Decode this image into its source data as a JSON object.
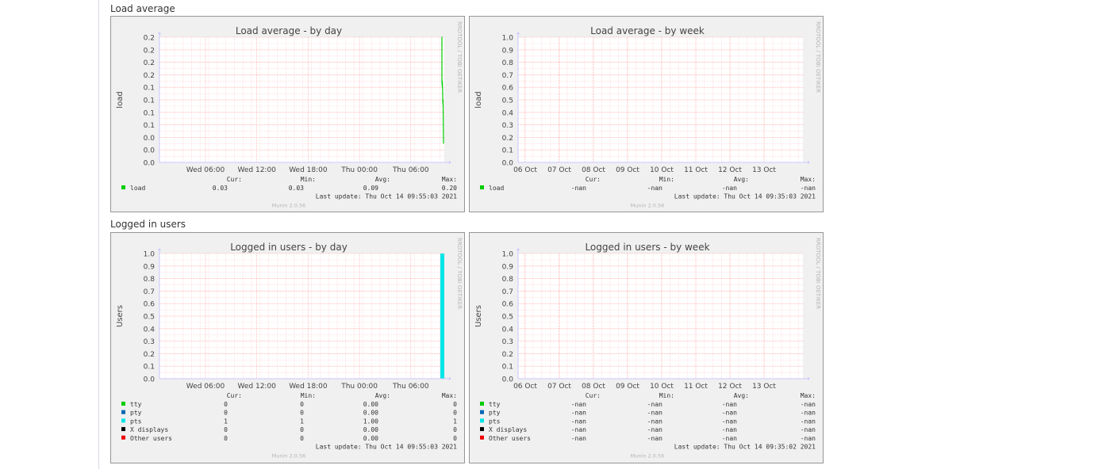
{
  "sections": [
    {
      "title": "Load average"
    },
    {
      "title": "Logged in users"
    }
  ],
  "side_text": "RRDTOOL / TOBI OETIKER",
  "footer_credit": "Munin 2.0.56",
  "labels": {
    "cur": "Cur:",
    "min": "Min:",
    "avg": "Avg:",
    "max": "Max:"
  },
  "colors": {
    "grid": "#ff9999",
    "axis": "#c8c8ff",
    "green": "#00cc00",
    "violet": "#0066b3",
    "cyan": "#00e6e6",
    "black": "#000000",
    "red": "#ee0000"
  },
  "chart_data": [
    {
      "type": "line",
      "title": "Load average - by day",
      "ylabel": "load",
      "x_ticks": [
        "Wed 06:00",
        "Wed 12:00",
        "Wed 18:00",
        "Thu 00:00",
        "Thu 06:00"
      ],
      "y_ticks": [
        "0.0",
        "0.0",
        "0.0",
        "0.1",
        "0.1",
        "0.1",
        "0.1",
        "0.2",
        "0.2",
        "0.2",
        "0.2"
      ],
      "ylim": [
        0,
        0.2
      ],
      "legend": [
        {
          "name": "load",
          "color": "#00cc00",
          "cur": "0.03",
          "min": "0.03",
          "avg": "0.09",
          "max": "0.20"
        }
      ],
      "series": [
        {
          "name": "load",
          "color": "#00cc00",
          "shape": "line",
          "points": [
            [
              0.2,
              0.2
            ],
            [
              0.2,
              0.13
            ],
            [
              0.12,
              0.13
            ],
            [
              0.11,
              0.1
            ],
            [
              0.09,
              0.1
            ],
            [
              0.03,
              0.03
            ]
          ]
        }
      ],
      "last_update": "Last update: Thu Oct 14 09:55:03 2021"
    },
    {
      "type": "line",
      "title": "Load average - by week",
      "ylabel": "load",
      "x_ticks": [
        "06 Oct",
        "07 Oct",
        "08 Oct",
        "09 Oct",
        "10 Oct",
        "11 Oct",
        "12 Oct",
        "13 Oct"
      ],
      "y_ticks": [
        "0.0",
        "0.1",
        "0.2",
        "0.3",
        "0.4",
        "0.5",
        "0.6",
        "0.7",
        "0.8",
        "0.9",
        "1.0"
      ],
      "ylim": [
        0,
        1
      ],
      "legend": [
        {
          "name": "load",
          "color": "#00cc00",
          "cur": "-nan",
          "min": "-nan",
          "avg": "-nan",
          "max": "-nan"
        }
      ],
      "series": [],
      "last_update": "Last update: Thu Oct 14 09:35:03 2021"
    },
    {
      "type": "area",
      "title": "Logged in users - by day",
      "ylabel": "Users",
      "x_ticks": [
        "Wed 06:00",
        "Wed 12:00",
        "Wed 18:00",
        "Thu 00:00",
        "Thu 06:00"
      ],
      "y_ticks": [
        "0.0",
        "0.1",
        "0.2",
        "0.3",
        "0.4",
        "0.5",
        "0.6",
        "0.7",
        "0.8",
        "0.9",
        "1.0"
      ],
      "ylim": [
        0,
        1
      ],
      "legend": [
        {
          "name": "tty",
          "color": "#00cc00",
          "cur": "0",
          "min": "0",
          "avg": "0.00",
          "max": "0"
        },
        {
          "name": "pty",
          "color": "#0066b3",
          "cur": "0",
          "min": "0",
          "avg": "0.00",
          "max": "0"
        },
        {
          "name": "pts",
          "color": "#00e6e6",
          "cur": "1",
          "min": "1",
          "avg": "1.00",
          "max": "1"
        },
        {
          "name": "X displays",
          "color": "#000000",
          "cur": "0",
          "min": "0",
          "avg": "0.00",
          "max": "0"
        },
        {
          "name": "Other users",
          "color": "#ee0000",
          "cur": "0",
          "min": "0",
          "avg": "0.00",
          "max": "0"
        }
      ],
      "series": [
        {
          "name": "pts",
          "color": "#00e6e6",
          "shape": "bar",
          "value": 1
        }
      ],
      "last_update": "Last update: Thu Oct 14 09:55:03 2021"
    },
    {
      "type": "area",
      "title": "Logged in users - by week",
      "ylabel": "Users",
      "x_ticks": [
        "06 Oct",
        "07 Oct",
        "08 Oct",
        "09 Oct",
        "10 Oct",
        "11 Oct",
        "12 Oct",
        "13 Oct"
      ],
      "y_ticks": [
        "0.0",
        "0.1",
        "0.2",
        "0.3",
        "0.4",
        "0.5",
        "0.6",
        "0.7",
        "0.8",
        "0.9",
        "1.0"
      ],
      "ylim": [
        0,
        1
      ],
      "legend": [
        {
          "name": "tty",
          "color": "#00cc00",
          "cur": "-nan",
          "min": "-nan",
          "avg": "-nan",
          "max": "-nan"
        },
        {
          "name": "pty",
          "color": "#0066b3",
          "cur": "-nan",
          "min": "-nan",
          "avg": "-nan",
          "max": "-nan"
        },
        {
          "name": "pts",
          "color": "#00e6e6",
          "cur": "-nan",
          "min": "-nan",
          "avg": "-nan",
          "max": "-nan"
        },
        {
          "name": "X displays",
          "color": "#000000",
          "cur": "-nan",
          "min": "-nan",
          "avg": "-nan",
          "max": "-nan"
        },
        {
          "name": "Other users",
          "color": "#ee0000",
          "cur": "-nan",
          "min": "-nan",
          "avg": "-nan",
          "max": "-nan"
        }
      ],
      "series": [],
      "last_update": "Last update: Thu Oct 14 09:35:02 2021"
    }
  ]
}
